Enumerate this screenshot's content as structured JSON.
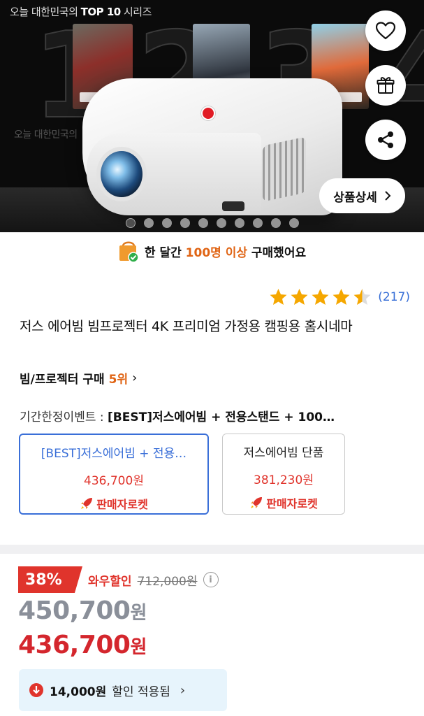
{
  "hero": {
    "caption_top_prefix": "오늘 대한민국의 ",
    "caption_top_bold": "TOP 10",
    "caption_top_suffix": " 시리즈",
    "caption_mid": "오늘 대한민국의",
    "ranks": [
      "1",
      "2",
      "3",
      "4"
    ],
    "detail_button_label": "상품상세",
    "slide_count": 10,
    "active_slide": 1
  },
  "purchase": {
    "prefix": "한 달간 ",
    "highlight": "100명 이상",
    "suffix": " 구매했어요"
  },
  "rating": {
    "stars": 4.5,
    "count_text": "(217)"
  },
  "product": {
    "title": "저스 에어빔 빔프로젝터 4K 프리미엄 가정용 캠핑용 홈시네마"
  },
  "rank": {
    "category": "빔/프로젝터 구매 ",
    "position": "5위",
    "chevron": "›"
  },
  "event": {
    "label": "기간한정이벤트 : ",
    "value": "[BEST]저스에어빔 + 전용스탠드 + 100…"
  },
  "options": [
    {
      "name": "[BEST]저스에어빔 + 전용…",
      "price": "436,700원",
      "badge": "판매자로켓"
    },
    {
      "name": "저스에어빔 단품",
      "price": "381,230원",
      "badge": "판매자로켓"
    }
  ],
  "pricing": {
    "discount_pct": "38%",
    "wow_label": "와우할인",
    "original_price": "712,000원",
    "sale_price_num": "450,700",
    "final_price_num": "436,700",
    "won": "원"
  },
  "coupon": {
    "amount": "14,000원",
    "text": "할인 적용됨",
    "chevron": "›"
  },
  "colors": {
    "accent_orange": "#e06414",
    "accent_red": "#e0342c",
    "link_blue": "#356dd6",
    "option_selected": "#3a6fd8",
    "star_gold": "#f5a700"
  }
}
